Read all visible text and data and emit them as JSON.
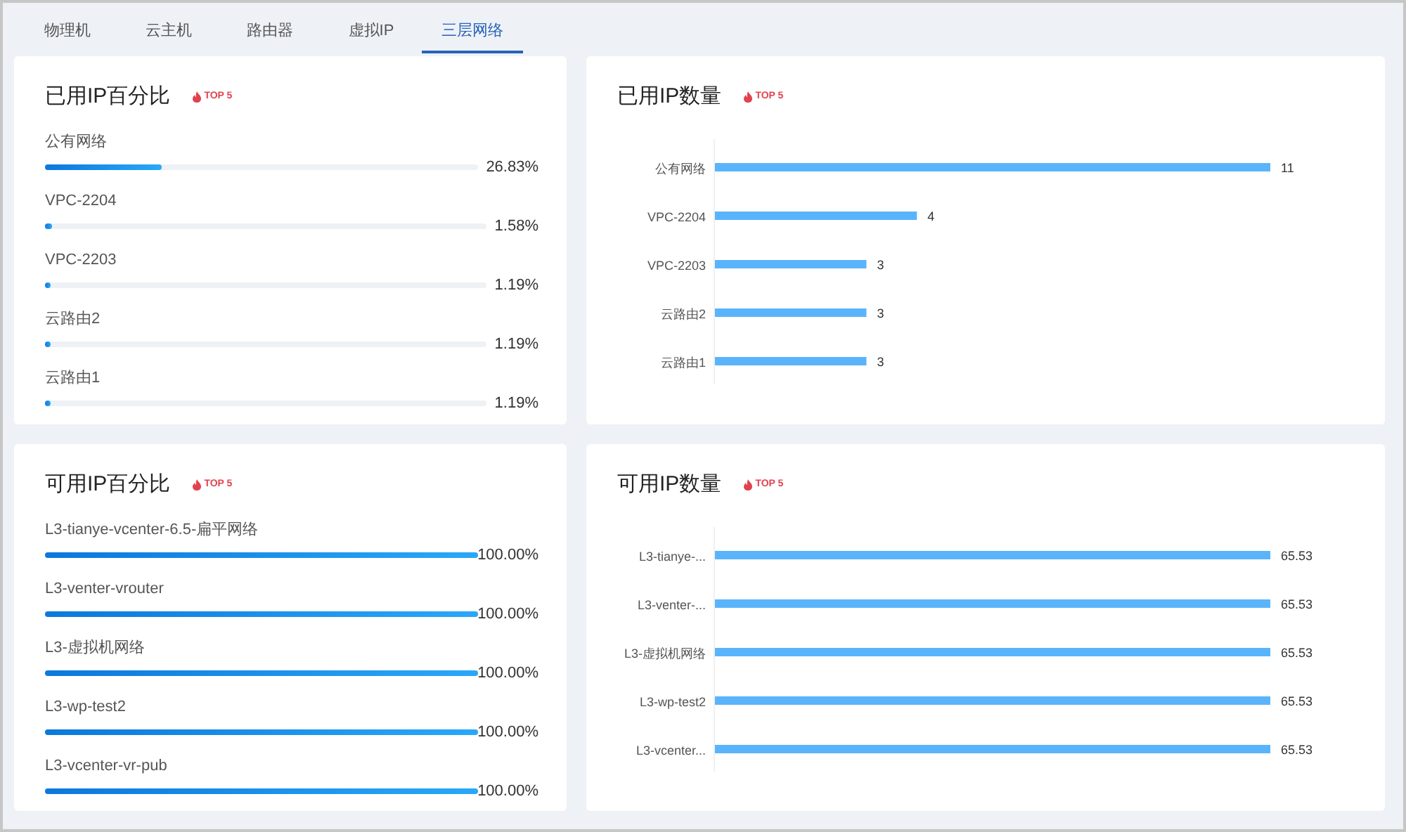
{
  "tabs": [
    {
      "label": "物理机",
      "selected": false
    },
    {
      "label": "云主机",
      "selected": false
    },
    {
      "label": "路由器",
      "selected": false
    },
    {
      "label": "虚拟IP",
      "selected": false
    },
    {
      "label": "三层网络",
      "selected": true
    }
  ],
  "panels": [
    {
      "kind": "list",
      "title": "已用IP百分比",
      "badge": "TOP 5",
      "items": [
        {
          "name": "公有网络",
          "reading": "26.83%",
          "level": 0.2683
        },
        {
          "name": "VPC-2204",
          "reading": "1.58%",
          "level": 0.0158
        },
        {
          "name": "VPC-2203",
          "reading": "1.19%",
          "level": 0.0119
        },
        {
          "name": "云路由2",
          "reading": "1.19%",
          "level": 0.0119
        },
        {
          "name": "云路由1",
          "reading": "1.19%",
          "level": 0.0119
        }
      ]
    },
    {
      "kind": "chart",
      "title": "已用IP数量",
      "badge": "TOP 5",
      "chart_data": {
        "type": "bar",
        "orientation": "horizontal",
        "categories": [
          "公有网络",
          "VPC-2204",
          "VPC-2203",
          "云路由2",
          "云路由1"
        ],
        "series": [
          {
            "color": "#5ab4fc",
            "values": [
              11,
              4,
              3,
              3,
              3
            ]
          }
        ],
        "data_labels": true
      }
    },
    {
      "kind": "list",
      "title": "可用IP百分比",
      "badge": "TOP 5",
      "items": [
        {
          "name": "L3-tianye-vcenter-6.5-扁平网络",
          "reading": "100.00%",
          "level": 1
        },
        {
          "name": "L3-venter-vrouter",
          "reading": "100.00%",
          "level": 1
        },
        {
          "name": "L3-虚拟机网络",
          "reading": "100.00%",
          "level": 1
        },
        {
          "name": "L3-wp-test2",
          "reading": "100.00%",
          "level": 1
        },
        {
          "name": "L3-vcenter-vr-pub",
          "reading": "100.00%",
          "level": 1
        }
      ]
    },
    {
      "kind": "chart",
      "title": "可用IP数量",
      "badge": "TOP 5",
      "chart_data": {
        "type": "bar",
        "orientation": "horizontal",
        "categories": [
          "L3-tianye-...",
          "L3-venter-...",
          "L3-虚拟机网络",
          "L3-wp-test2",
          "L3-vcenter..."
        ],
        "series": [
          {
            "color": "#5ab4fc",
            "values": [
              65.53,
              65.53,
              65.53,
              65.53,
              65.53
            ]
          }
        ],
        "data_labels": true
      }
    }
  ]
}
